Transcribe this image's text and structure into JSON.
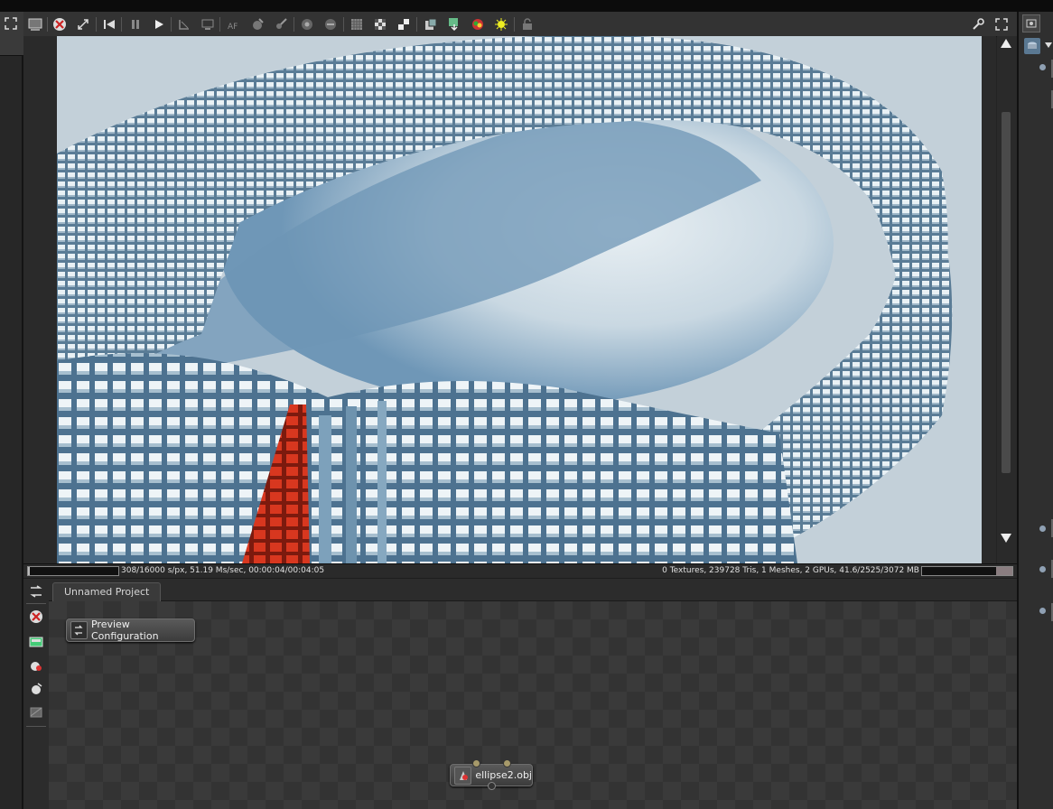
{
  "viewer": {
    "status_left": "308/16000 s/px, 51.19 Ms/sec, 00:00:04/00:04:05",
    "status_right": "0 Textures, 239728 Tris, 1 Meshes, 2 GPUs, 41.6/2525/3072 MB",
    "progress_fraction": 0.02
  },
  "graph": {
    "tab_label": "Unnamed Project",
    "nodes": {
      "preview_config_label": "Preview Configuration",
      "mesh_label": "ellipse2.obj"
    }
  },
  "toolbar_icons": [
    "fullscreen-icon",
    "render-region-icon",
    "stop-icon",
    "reset-icon",
    "restart-icon",
    "pause-icon",
    "play-icon",
    "focus-picker-icon",
    "white-balance-icon",
    "autofocus-icon",
    "material-picker-icon",
    "object-picker-icon",
    "camera-target-icon",
    "texture-icon",
    "checker-icon",
    "alpha-icon",
    "save-icon",
    "export-icon",
    "color-picker-icon",
    "sun-icon",
    "lock-icon",
    "settings-wrench-icon",
    "maximize-icon"
  ],
  "colors": {
    "render_sky": "#c6d3dc",
    "render_floor": "#6f97b7",
    "red_highlight": "#c2321e"
  }
}
